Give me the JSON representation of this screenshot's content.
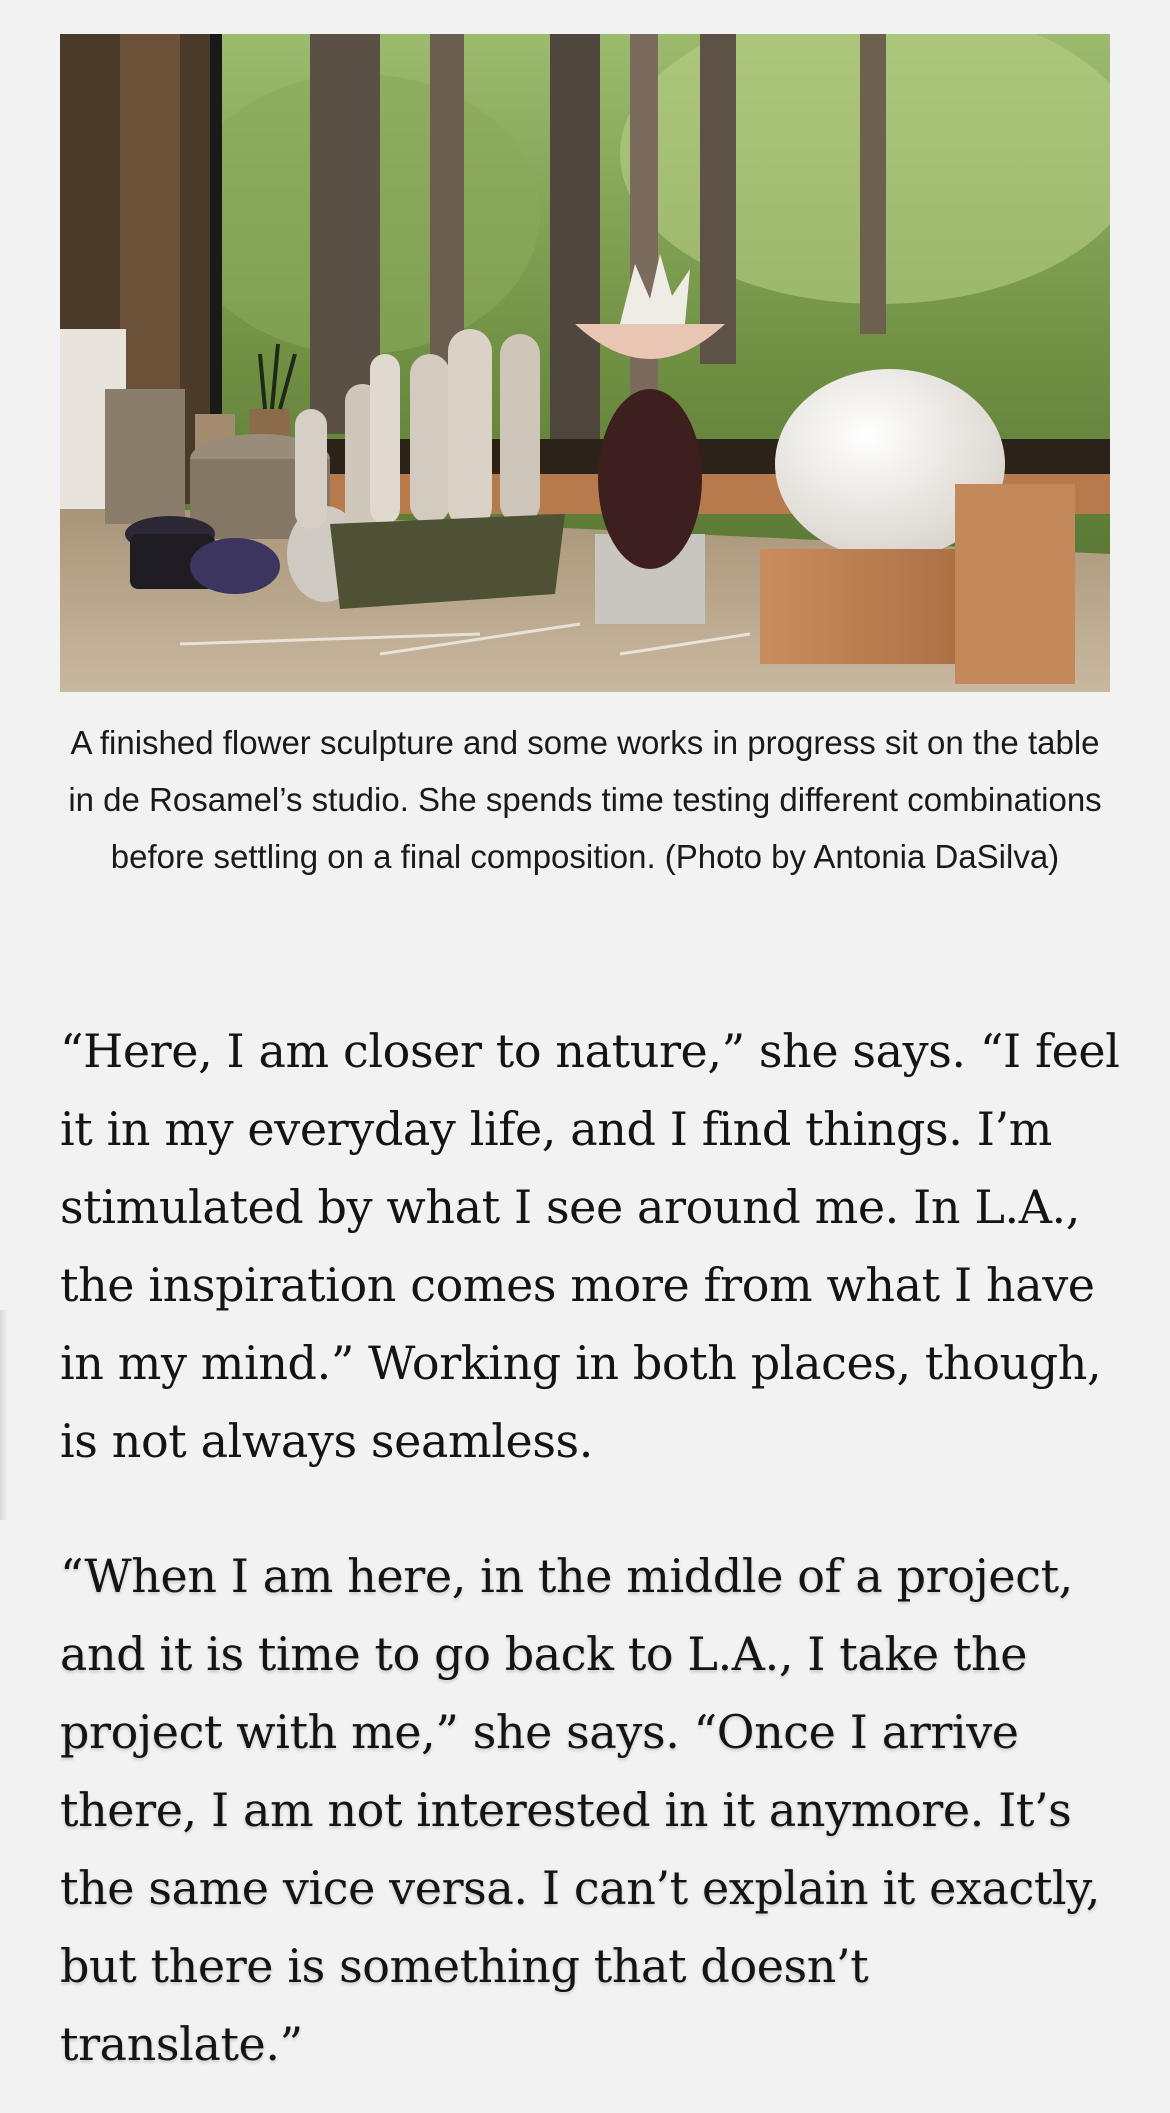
{
  "article": {
    "image": {
      "alt": "A finished flower sculpture and some works in progress on a studio table in front of a window overlooking a forest"
    },
    "caption": "A finished flower sculpture and some works in progress sit on the table in de Rosamel’s studio. She spends time testing different combinations before settling on a final composition. (Photo by Antonia DaSilva)",
    "paragraphs": [
      "“Here, I am closer to nature,” she says. “I feel it in my everyday life, and I find things. I’m stimulated by what I see around me. In L.A., the inspiration comes more from what I have in my mind.” Working in both places, though, is not always seamless.",
      "“When I am here, in the middle of a project, and it is time to go back to L.A., I take the project with me,” she says. “Once I arrive there, I am not interested in it anymore. It’s the same vice versa. I can’t explain it exactly, but there is something that doesn’t translate.”"
    ]
  },
  "colors": {
    "background": "#f2f2f2",
    "text": "#141414"
  }
}
